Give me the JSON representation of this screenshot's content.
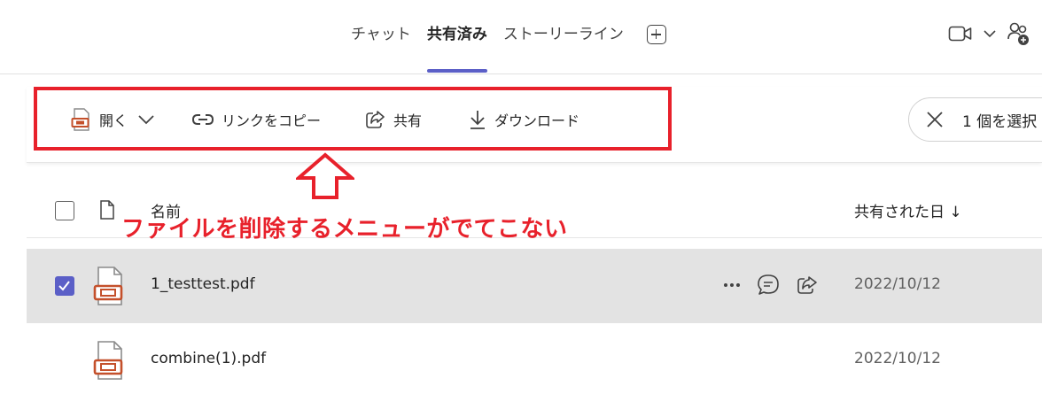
{
  "header": {
    "tabs": [
      {
        "label": "チャット"
      },
      {
        "label": "共有済み"
      },
      {
        "label": "ストーリーライン"
      }
    ]
  },
  "toolbar": {
    "open_label": "開く",
    "copy_link_label": "リンクをコピー",
    "share_label": "共有",
    "download_label": "ダウンロード",
    "selection_label": "1 個を選択"
  },
  "annotation": {
    "text": "ファイルを削除するメニューがでてこない",
    "color": "#e8212b"
  },
  "list": {
    "name_header": "名前",
    "date_header": "共有された日 ↓",
    "rows": [
      {
        "name": "1_testtest.pdf",
        "date": "2022/10/12"
      },
      {
        "name": "combine(1).pdf",
        "date": "2022/10/12"
      }
    ]
  },
  "colors": {
    "accent": "#5b5fc7",
    "pdf_icon": "#c4502b",
    "highlight": "#e8212b"
  }
}
